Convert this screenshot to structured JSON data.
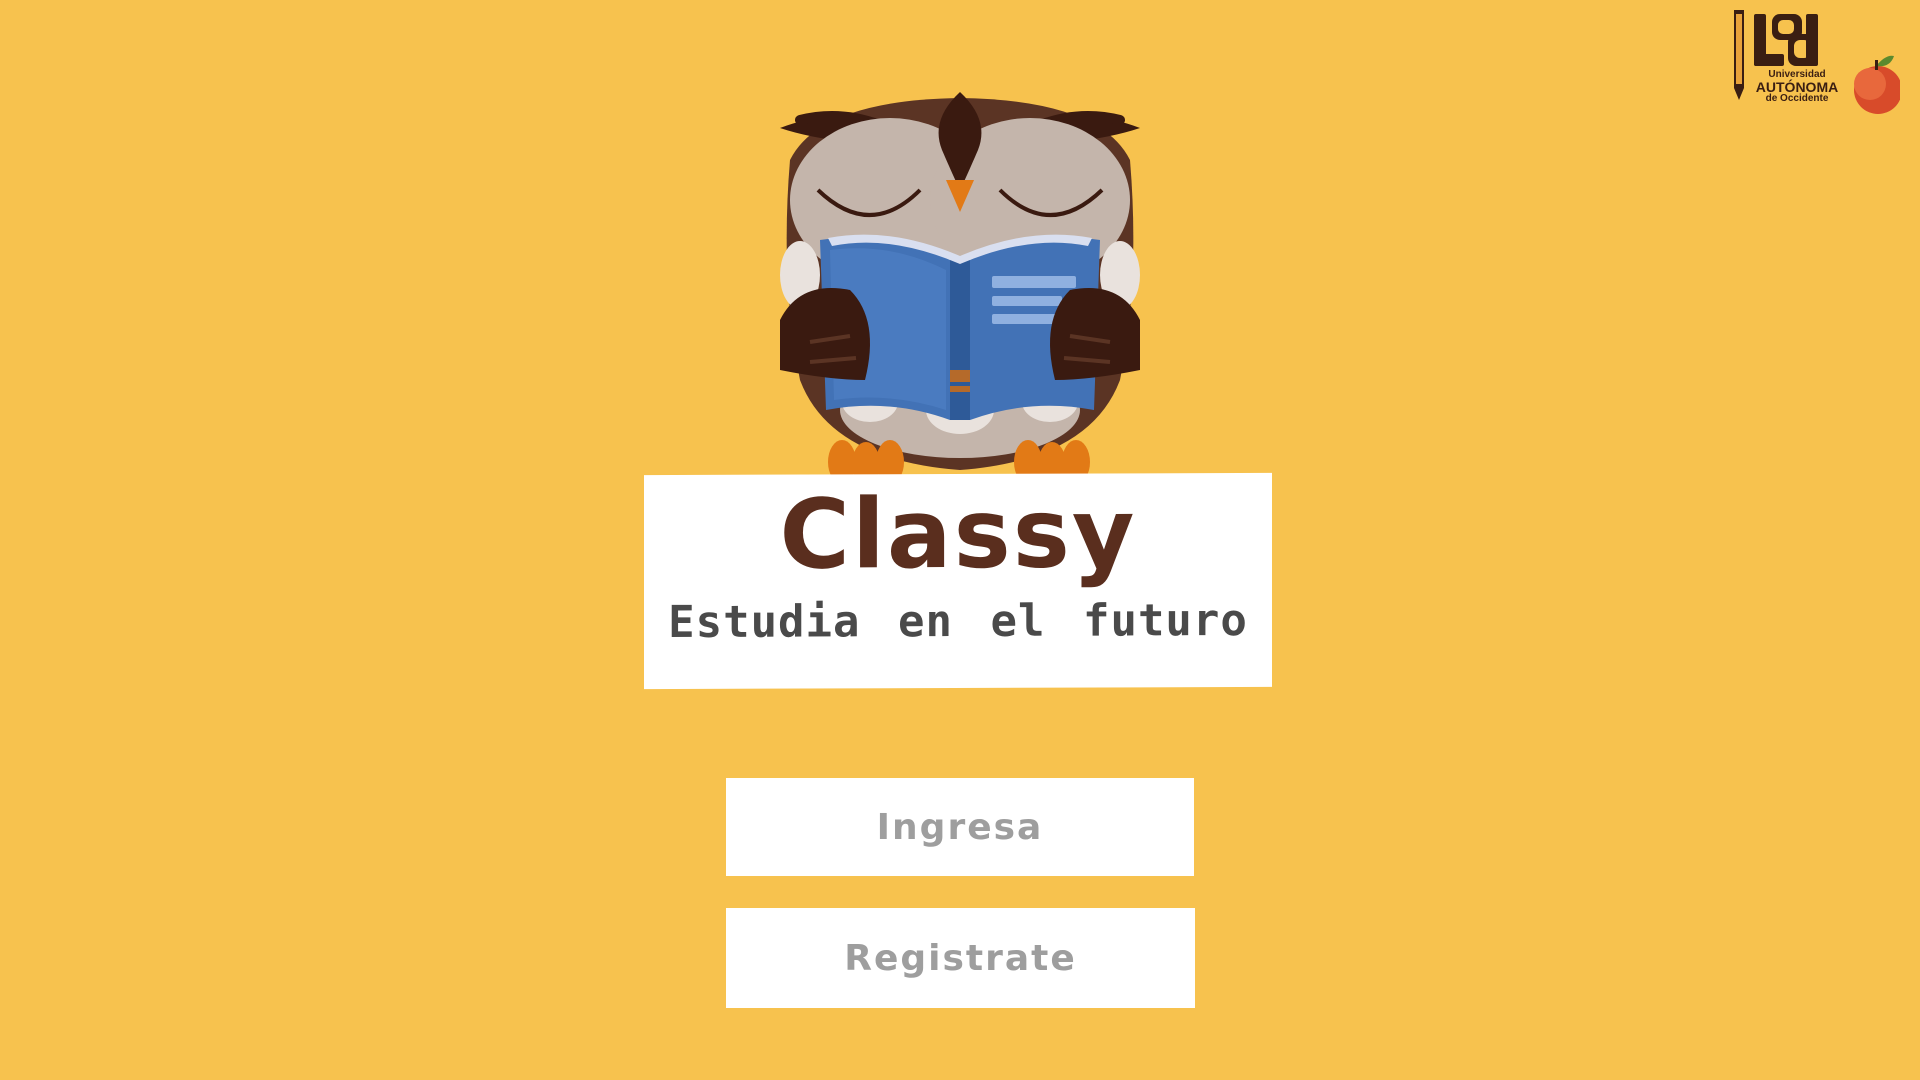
{
  "app": {
    "title": "Classy",
    "tagline": "Estudia en el futuro"
  },
  "buttons": {
    "login_label": "Ingresa",
    "register_label": "Registrate"
  },
  "university_logo": {
    "line1": "Universidad",
    "line2": "AUTÓNOMA",
    "line3": "de Occidente"
  },
  "icons": {
    "mascot": "owl-reading-book-icon",
    "logo": "university-logo-icon",
    "apple": "apple-icon"
  },
  "colors": {
    "background": "#F7C24E",
    "title": "#5A2E1E",
    "subtitle": "#4a4a4a",
    "button_text": "#9e9e9e",
    "card": "#ffffff"
  }
}
